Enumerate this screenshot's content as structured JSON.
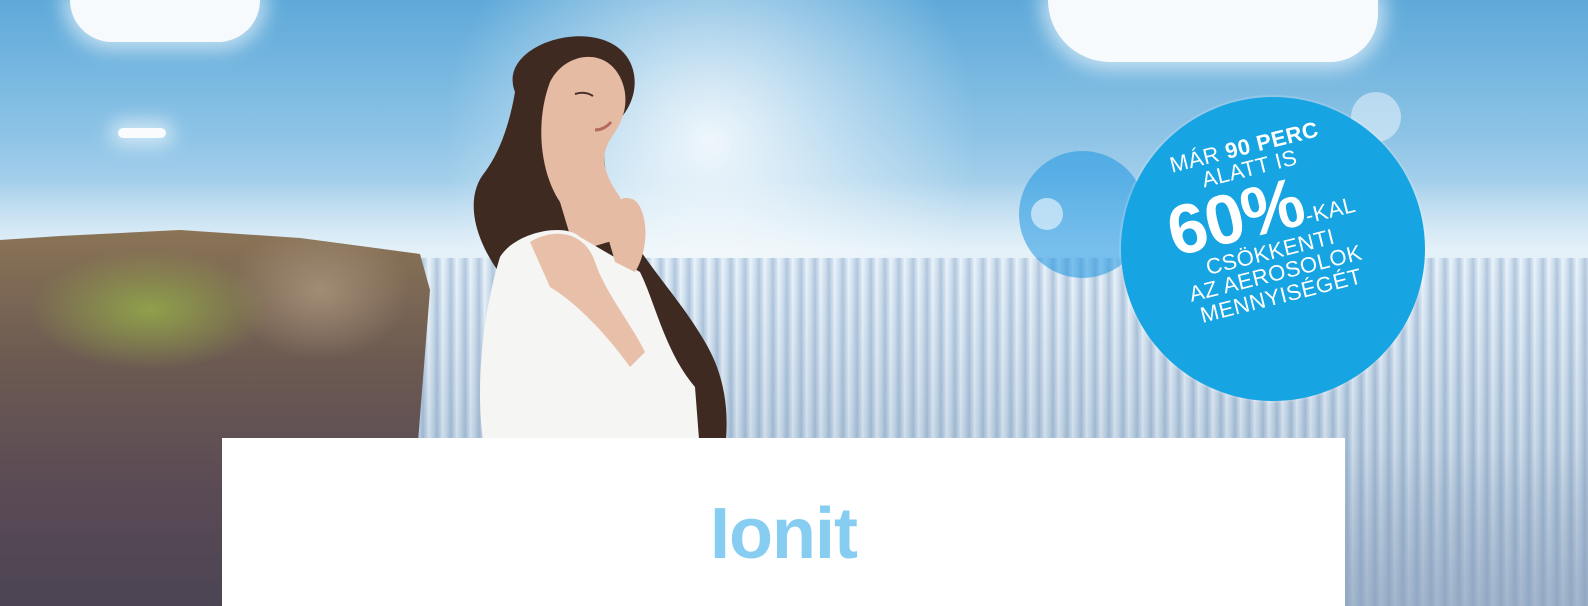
{
  "hero": {
    "badge": {
      "line1_prefix": "MÁR",
      "line1_bold": "90 PERC",
      "line2": "ALATT IS",
      "percent": "60%",
      "percent_suffix": "-KAL",
      "line4": "CSÖKKENTI",
      "line5": "AZ AEROSOLOK",
      "line6": "MENNYISÉGÉT",
      "color": "#16a4e2"
    }
  },
  "content": {
    "title": "Ionit",
    "title_color": "#86cdf1"
  }
}
